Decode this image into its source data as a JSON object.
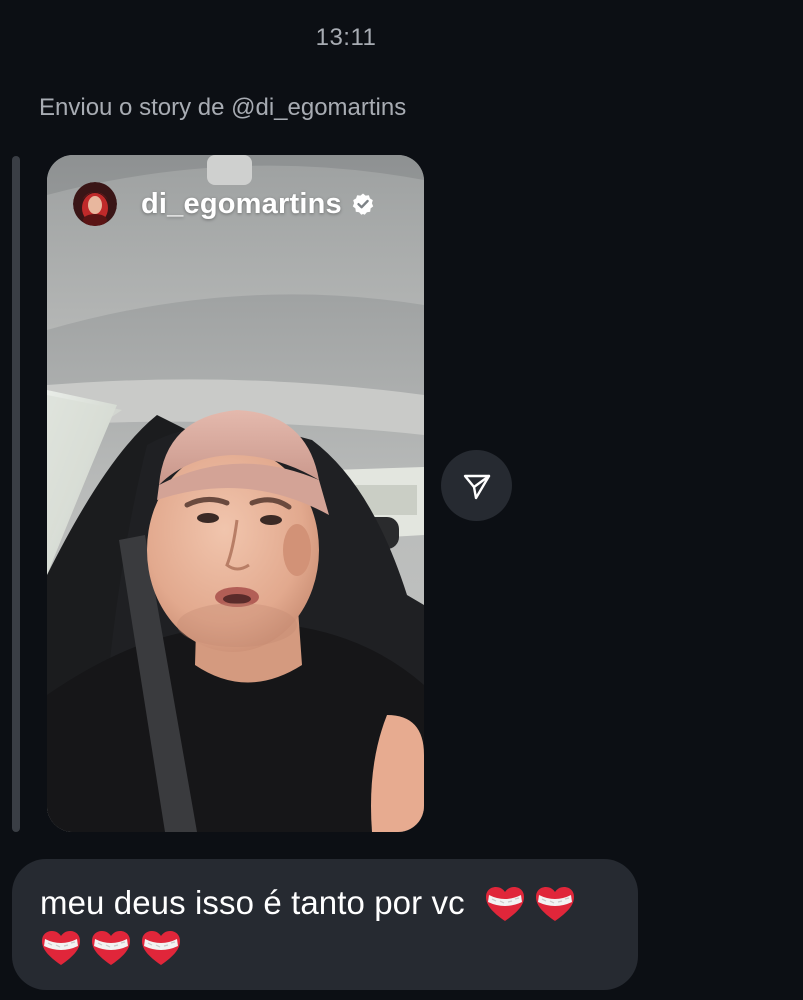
{
  "status": {
    "time": "13:11"
  },
  "story": {
    "caption": "Enviou o story de @di_egomartins",
    "username": "di_egomartins",
    "verified": true,
    "avatar_icon": "profile-avatar",
    "share_icon": "paper-plane-icon"
  },
  "message": {
    "text": "meu deus isso é tanto por vc",
    "emoji_icon": "mending-heart-emoji",
    "emoji_count": 5,
    "emoji_glyph": "❤️‍🩹"
  },
  "colors": {
    "background": "#0c0f14",
    "bubble": "#262a31",
    "meta_text": "#a8acb3",
    "heart_red": "#e0263a"
  }
}
